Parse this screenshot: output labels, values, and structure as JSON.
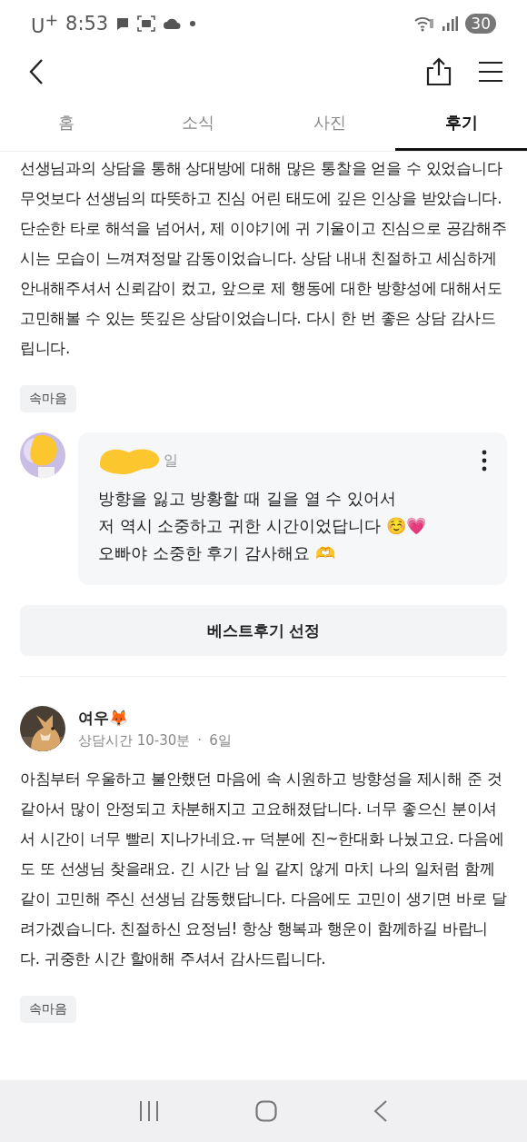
{
  "status_bar": {
    "carrier": "U$^{+}$",
    "time": "8:53",
    "battery": "30"
  },
  "tabs": [
    {
      "label": "홈",
      "selected": false
    },
    {
      "label": "소식",
      "selected": false
    },
    {
      "label": "사진",
      "selected": false
    },
    {
      "label": "후기",
      "selected": true
    }
  ],
  "reviews": [
    {
      "kind": "continued",
      "text": "선생님과의 상담을 통해 상대방에 대해 많은 통찰을 얻을 수 있었습니다 무엇보다 선생님의 따뜻하고 진심 어린 태도에 깊은 인상을 받았습니다. 단순한 타로 해석을 넘어서, 제 이야기에 귀 기울이고 진심으로 공감해주시는 모습이 느껴져정말 감동이었습니다. 상담 내내 친절하고 세심하게 안내해주셔서 신뢰감이 컸고, 앞으로 제 행동에 대한 방향성에 대해서도 고민해볼 수 있는 뜻깊은 상담이었습니다. 다시 한 번 좋은 상담 감사드립니다.",
      "tag": "속마음",
      "reply": {
        "date": "일",
        "lines": [
          "방향을 잃고 방황할 때 길을 열 수 있어서",
          "저 역시 소중하고 귀한 시간이었답니다 ☺️💗",
          "오빠야 소중한 후기 감사해요 🫶"
        ]
      },
      "button": "베스트후기 선정"
    },
    {
      "kind": "full",
      "name": "여우🦊",
      "meta": "상담시간 10-30분",
      "separator": "·",
      "date": "6일",
      "text": "아침부터 우울하고 불안했던 마음에 속 시원하고 방향성을 제시해 준 것 같아서 많이 안정되고 차분해지고 고요해졌답니다. 너무 좋으신 분이셔서 시간이 너무 빨리 지나가네요.ㅠ 덕분에 진~한대화 나눴고요. 다음에도 또 선생님 찾을래요. 긴 시간 남 일 같지 않게 마치 나의 일처럼 함께 같이 고민해 주신 선생님 감동했답니다. 다음에도 고민이 생기면 바로 달려가겠습니다. 친절하신 요정님! 항상 행복과 행운이 함께하길 바랍니다. 귀중한 시간 할애해 주셔서 감사드립니다.",
      "tag": "속마음"
    }
  ]
}
